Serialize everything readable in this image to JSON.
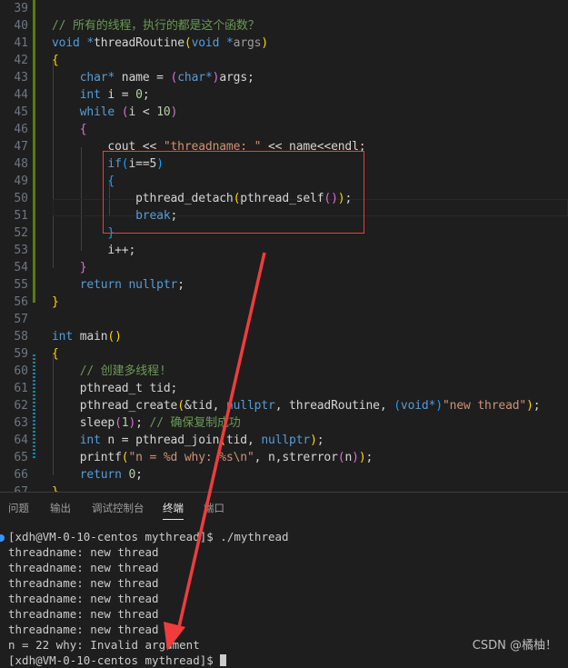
{
  "editor": {
    "first_line": 39,
    "lines": [
      [],
      [
        [
          "// 所有的线程，执行的都是这个函数？",
          "cm"
        ]
      ],
      [
        [
          "void ",
          "kw"
        ],
        [
          "*",
          "kw"
        ],
        [
          "threadRoutine",
          "pl"
        ],
        [
          "(",
          "b1"
        ],
        [
          "void ",
          "kw"
        ],
        [
          "*",
          "kw"
        ],
        [
          "args",
          "pa"
        ],
        [
          ")",
          "b1"
        ]
      ],
      [
        [
          "{",
          "b1"
        ]
      ],
      [
        [
          "    ",
          "pl"
        ],
        [
          "char",
          "kw"
        ],
        [
          "*",
          "kw"
        ],
        [
          " name = ",
          "pl"
        ],
        [
          "(",
          "b2"
        ],
        [
          "char",
          "kw"
        ],
        [
          "*",
          "kw"
        ],
        [
          ")",
          "b2"
        ],
        [
          "args;",
          "pl"
        ]
      ],
      [
        [
          "    ",
          "pl"
        ],
        [
          "int",
          "kw"
        ],
        [
          " i = ",
          "pl"
        ],
        [
          "0",
          "num"
        ],
        [
          ";",
          "pl"
        ]
      ],
      [
        [
          "    ",
          "pl"
        ],
        [
          "while",
          "kw"
        ],
        [
          " ",
          "pl"
        ],
        [
          "(",
          "b2"
        ],
        [
          "i < ",
          "pl"
        ],
        [
          "10",
          "num"
        ],
        [
          ")",
          "b2"
        ]
      ],
      [
        [
          "    ",
          "pl"
        ],
        [
          "{",
          "b2"
        ]
      ],
      [
        [
          "        cout << ",
          "pl"
        ],
        [
          "\"threadname: \"",
          "str"
        ],
        [
          " << name<<endl;",
          "pl"
        ]
      ],
      [
        [
          "        ",
          "pl"
        ],
        [
          "if",
          "kw"
        ],
        [
          "(",
          "b3"
        ],
        [
          "i==5",
          "pl"
        ],
        [
          ")",
          "b3"
        ]
      ],
      [
        [
          "        ",
          "pl"
        ],
        [
          "{",
          "b3"
        ]
      ],
      [
        [
          "            pthread_detach",
          "pl"
        ],
        [
          "(",
          "b1"
        ],
        [
          "pthread_self",
          "pl"
        ],
        [
          "(",
          "b2"
        ],
        [
          ")",
          "b2"
        ],
        [
          ")",
          "b1"
        ],
        [
          ";",
          "pl"
        ]
      ],
      [
        [
          "            ",
          "pl"
        ],
        [
          "break",
          "kw"
        ],
        [
          ";",
          "pl"
        ]
      ],
      [
        [
          "        ",
          "pl"
        ],
        [
          "}",
          "b3"
        ]
      ],
      [
        [
          "        i++;",
          "pl"
        ]
      ],
      [
        [
          "    ",
          "pl"
        ],
        [
          "}",
          "b2"
        ]
      ],
      [
        [
          "    ",
          "pl"
        ],
        [
          "return",
          "kw"
        ],
        [
          " ",
          "pl"
        ],
        [
          "nullptr",
          "kw"
        ],
        [
          ";",
          "pl"
        ]
      ],
      [
        [
          "}",
          "b1"
        ]
      ],
      [],
      [
        [
          "int",
          "kw"
        ],
        [
          " main",
          "pl"
        ],
        [
          "()",
          "b1"
        ]
      ],
      [
        [
          "{",
          "b1"
        ]
      ],
      [
        [
          "    ",
          "pl"
        ],
        [
          "// 创建多线程!",
          "cm"
        ]
      ],
      [
        [
          "    pthread_t tid;",
          "pl"
        ]
      ],
      [
        [
          "    pthread_create",
          "pl"
        ],
        [
          "(",
          "b1"
        ],
        [
          "&tid, ",
          "pl"
        ],
        [
          "nullptr",
          "kw"
        ],
        [
          ", threadRoutine, ",
          "pl"
        ],
        [
          "(",
          "b3"
        ],
        [
          "void",
          "kw"
        ],
        [
          "*",
          "kw"
        ],
        [
          ")",
          "b3"
        ],
        [
          "\"new thread\"",
          "str"
        ],
        [
          ")",
          "b1"
        ],
        [
          ";",
          "pl"
        ]
      ],
      [
        [
          "    sleep",
          "pl"
        ],
        [
          "(",
          "b2"
        ],
        [
          "1",
          "num"
        ],
        [
          ")",
          "b2"
        ],
        [
          "; ",
          "pl"
        ],
        [
          "// 确保复制成功",
          "cm"
        ]
      ],
      [
        [
          "    ",
          "pl"
        ],
        [
          "int",
          "kw"
        ],
        [
          " n = pthread_join",
          "pl"
        ],
        [
          "(",
          "b1"
        ],
        [
          "tid, ",
          "pl"
        ],
        [
          "nullptr",
          "kw"
        ],
        [
          ")",
          "b1"
        ],
        [
          ";",
          "pl"
        ]
      ],
      [
        [
          "    printf",
          "pl"
        ],
        [
          "(",
          "b1"
        ],
        [
          "\"n = %d why: %s\\n\"",
          "str"
        ],
        [
          ", n,strerror",
          "pl"
        ],
        [
          "(",
          "b2"
        ],
        [
          "n",
          "pl"
        ],
        [
          ")",
          "b2"
        ],
        [
          ")",
          "b1"
        ],
        [
          ";",
          "pl"
        ]
      ],
      [
        [
          "    ",
          "pl"
        ],
        [
          "return",
          "kw"
        ],
        [
          " ",
          "pl"
        ],
        [
          "0",
          "num"
        ],
        [
          ";",
          "pl"
        ]
      ],
      [
        [
          "}",
          "b1"
        ]
      ]
    ]
  },
  "panel": {
    "tabs": [
      {
        "label": "问题"
      },
      {
        "label": "输出"
      },
      {
        "label": "调试控制台"
      },
      {
        "label": "终端",
        "active": true
      },
      {
        "label": "端口"
      }
    ],
    "terminal": [
      "[xdh@VM-0-10-centos mythread]$ ./mythread",
      "threadname: new thread",
      "threadname: new thread",
      "threadname: new thread",
      "threadname: new thread",
      "threadname: new thread",
      "threadname: new thread",
      "n = 22 why: Invalid argument",
      "[xdh@VM-0-10-centos mythread]$ "
    ]
  },
  "watermark": "CSDN @橘柚！",
  "annotation_color": "#f03c3c"
}
